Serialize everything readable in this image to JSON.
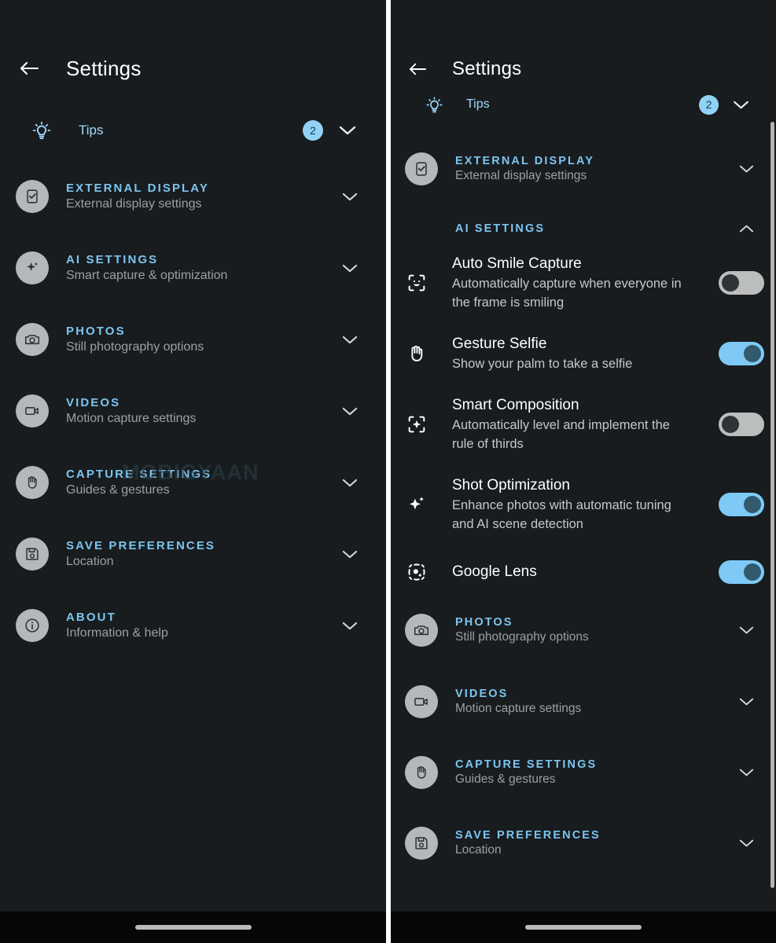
{
  "colors": {
    "background": "#181c1f",
    "accent_blue": "#7cc5ef",
    "badge_blue": "#92d3f5",
    "toggle_on": "#7ec9f5",
    "toggle_off": "#bcbdbd",
    "icon_circle": "#b5b8ba",
    "title_text": "#ffffff",
    "subtitle_text": "#9aa0a4",
    "divider": "#ffffff"
  },
  "watermark": {
    "text": "MOBIGYAAN"
  },
  "left_panel": {
    "header": {
      "title": "Settings",
      "back_icon": "arrow-left-icon"
    },
    "tips": {
      "icon": "lightbulb-icon",
      "label": "Tips",
      "badge": "2",
      "chevron": "chevron-down-icon"
    },
    "sections": [
      {
        "icon": "external-display-icon",
        "title": "EXTERNAL DISPLAY",
        "subtitle": "External display settings",
        "chevron": "chevron-down-icon"
      },
      {
        "icon": "sparkle-icon",
        "title": "AI SETTINGS",
        "subtitle": "Smart capture & optimization",
        "chevron": "chevron-down-icon"
      },
      {
        "icon": "camera-icon",
        "title": "PHOTOS",
        "subtitle": "Still photography options",
        "chevron": "chevron-down-icon"
      },
      {
        "icon": "video-camera-icon",
        "title": "VIDEOS",
        "subtitle": "Motion capture settings",
        "chevron": "chevron-down-icon"
      },
      {
        "icon": "hand-icon",
        "title": "CAPTURE SETTINGS",
        "subtitle": "Guides & gestures",
        "chevron": "chevron-down-icon"
      },
      {
        "icon": "floppy-disk-icon",
        "title": "SAVE PREFERENCES",
        "subtitle": "Location",
        "chevron": "chevron-down-icon"
      },
      {
        "icon": "info-icon",
        "title": "ABOUT",
        "subtitle": "Information & help",
        "chevron": "chevron-down-icon"
      }
    ],
    "nav_bar": {
      "pill": "home-gesture-pill"
    }
  },
  "right_panel": {
    "header": {
      "title": "Settings",
      "back_icon": "arrow-left-icon"
    },
    "tips": {
      "icon": "lightbulb-icon",
      "label": "Tips",
      "badge": "2",
      "chevron": "chevron-down-icon"
    },
    "external_display": {
      "icon": "external-display-icon",
      "title": "EXTERNAL DISPLAY",
      "subtitle": "External display settings",
      "chevron": "chevron-down-icon"
    },
    "ai_settings": {
      "title": "AI SETTINGS",
      "chevron": "chevron-up-icon",
      "expanded": true,
      "items": [
        {
          "icon": "face-smile-frame-icon",
          "title": "Auto Smile Capture",
          "subtitle": "Automatically capture when everyone in the frame is smiling",
          "toggle": "off"
        },
        {
          "icon": "hand-palm-icon",
          "title": "Gesture Selfie",
          "subtitle": "Show your palm to take a selfie",
          "toggle": "on"
        },
        {
          "icon": "sparkle-frame-icon",
          "title": "Smart Composition",
          "subtitle": "Automatically level and implement the rule of thirds",
          "toggle": "off"
        },
        {
          "icon": "sparkle-icon",
          "title": "Shot Optimization",
          "subtitle": "Enhance photos with automatic tuning and AI scene detection",
          "toggle": "on"
        },
        {
          "icon": "google-lens-icon",
          "title": "Google Lens",
          "subtitle": "",
          "toggle": "on"
        }
      ]
    },
    "sections": [
      {
        "icon": "camera-icon",
        "title": "PHOTOS",
        "subtitle": "Still photography options",
        "chevron": "chevron-down-icon"
      },
      {
        "icon": "video-camera-icon",
        "title": "VIDEOS",
        "subtitle": "Motion capture settings",
        "chevron": "chevron-down-icon"
      },
      {
        "icon": "hand-icon",
        "title": "CAPTURE SETTINGS",
        "subtitle": "Guides & gestures",
        "chevron": "chevron-down-icon"
      },
      {
        "icon": "floppy-disk-icon",
        "title": "SAVE PREFERENCES",
        "subtitle": "Location",
        "chevron": "chevron-down-icon"
      }
    ],
    "scrollbar": "vertical-scrollbar",
    "nav_bar": {
      "pill": "home-gesture-pill"
    }
  }
}
